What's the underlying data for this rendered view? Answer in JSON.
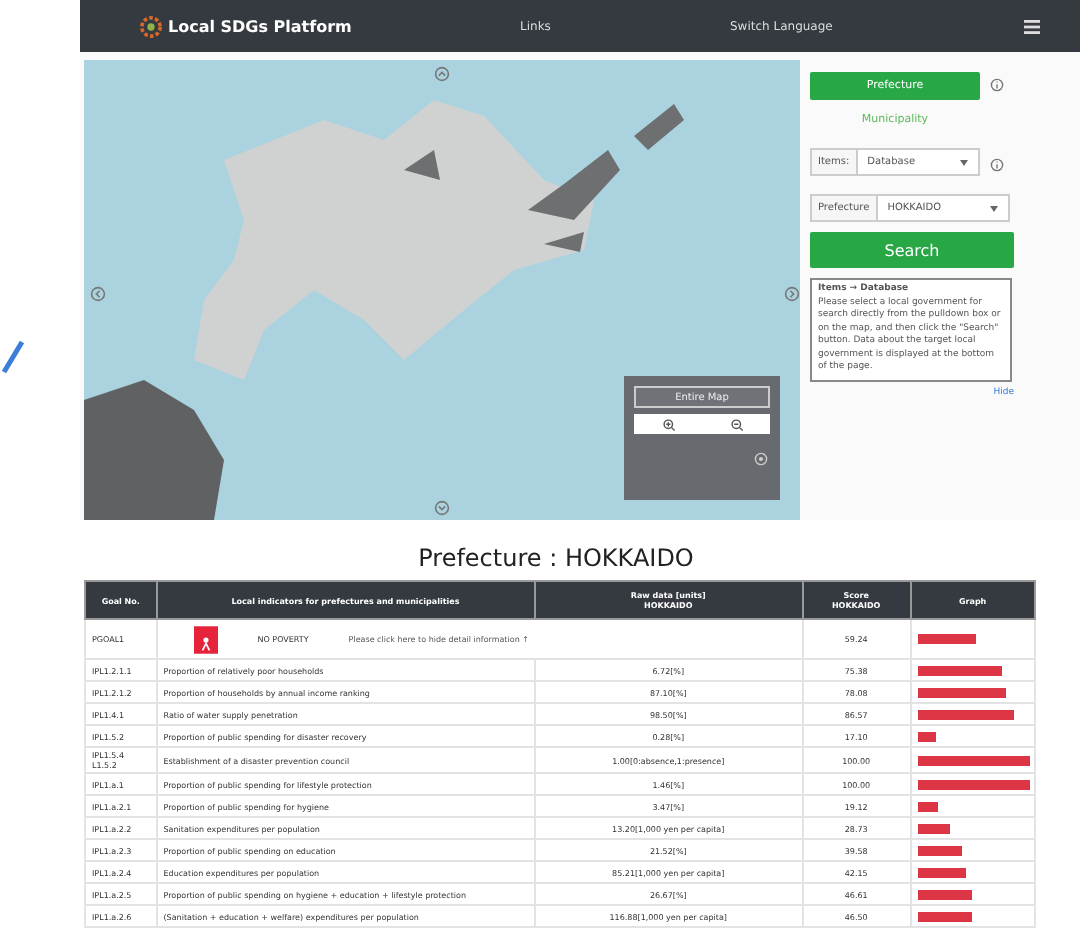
{
  "navbar": {
    "brand": "Local SDGs Platform",
    "links": [
      "Links",
      "Switch Language"
    ]
  },
  "map": {
    "entire_map_button": "Entire Map"
  },
  "search_panel": {
    "level_tabs": [
      {
        "label": "Prefecture",
        "selected": true
      },
      {
        "label": "Municipality",
        "selected": false
      }
    ],
    "items_select": {
      "label": "Items:",
      "value": "Database"
    },
    "prefecture_select": {
      "label": "Prefecture",
      "value": "HOKKAIDO"
    },
    "search_button": "Search",
    "help": {
      "title": "Items → Database",
      "text": "Please select a local government for search directly from the pulldown box or on the map, and then click the \"Search\" button. Data about the target local government is displayed at the bottom of the page."
    },
    "hide_link": "Hide"
  },
  "result": {
    "title": "Prefecture : HOKKAIDO",
    "columns": [
      {
        "label": "Goal No."
      },
      {
        "label": "Local indicators for prefectures and municipalities"
      },
      {
        "label": "Raw data [units]",
        "sublabel": "HOKKAIDO"
      },
      {
        "label": "Score",
        "sublabel": "HOKKAIDO"
      },
      {
        "label": "Graph"
      }
    ],
    "goal_row": {
      "goal_no": "PGOAL1",
      "goal_name": "NO POVERTY",
      "detail_link": "Please click here to hide detail information ↑",
      "score": "59.24",
      "level": 0.52
    },
    "rows": [
      {
        "goal_no": "IPL1.2.1.1",
        "indicator": "Proportion of relatively poor households",
        "raw": "6.72[%]",
        "score": "75.38",
        "level": 0.75
      },
      {
        "goal_no": "IPL1.2.1.2",
        "indicator": "Proportion of households by annual income ranking",
        "raw": "87.10[%]",
        "score": "78.08",
        "level": 0.79
      },
      {
        "goal_no": "IPL1.4.1",
        "indicator": "Ratio of water supply penetration",
        "raw": "98.50[%]",
        "score": "86.57",
        "level": 0.86
      },
      {
        "goal_no": "IPL1.5.2",
        "indicator": "Proportion of public spending for disaster recovery",
        "raw": "0.28[%]",
        "score": "17.10",
        "level": 0.17
      },
      {
        "goal_no": "IPL1.5.4 L1.5.2",
        "indicator": "Establishment of a disaster prevention council",
        "raw": "1.00[0:absence,1:presence]",
        "score": "100.00",
        "level": 1
      },
      {
        "goal_no": "IPL1.a.1",
        "indicator": "Proportion of public spending for lifestyle protection",
        "raw": "1.46[%]",
        "score": "100.00",
        "level": 1
      },
      {
        "goal_no": "IPL1.a.2.1",
        "indicator": "Proportion of public spending for hygiene",
        "raw": "3.47[%]",
        "score": "19.12",
        "level": 0.19
      },
      {
        "goal_no": "IPL1.a.2.2",
        "indicator": "Sanitation expenditures per population",
        "raw": "13.20[1,000 yen per capita]",
        "score": "28.73",
        "level": 0.29
      },
      {
        "goal_no": "IPL1.a.2.3",
        "indicator": "Proportion of public spending on education",
        "raw": "21.52[%]",
        "score": "39.58",
        "level": 0.4
      },
      {
        "goal_no": "IPL1.a.2.4",
        "indicator": "Education expenditures per population",
        "raw": "85.21[1,000 yen per capita]",
        "score": "42.15",
        "level": 0.43
      },
      {
        "goal_no": "IPL1.a.2.5",
        "indicator": "Proportion of public spending on hygiene + education + lifestyle protection",
        "raw": "26.67[%]",
        "score": "46.61",
        "level": 0.48
      },
      {
        "goal_no": "IPL1.a.2.6",
        "indicator": "(Sanitation + education + welfare) expenditures per population",
        "raw": "116.88[1,000 yen per capita]",
        "score": "46.50",
        "level": 0.48
      }
    ]
  }
}
